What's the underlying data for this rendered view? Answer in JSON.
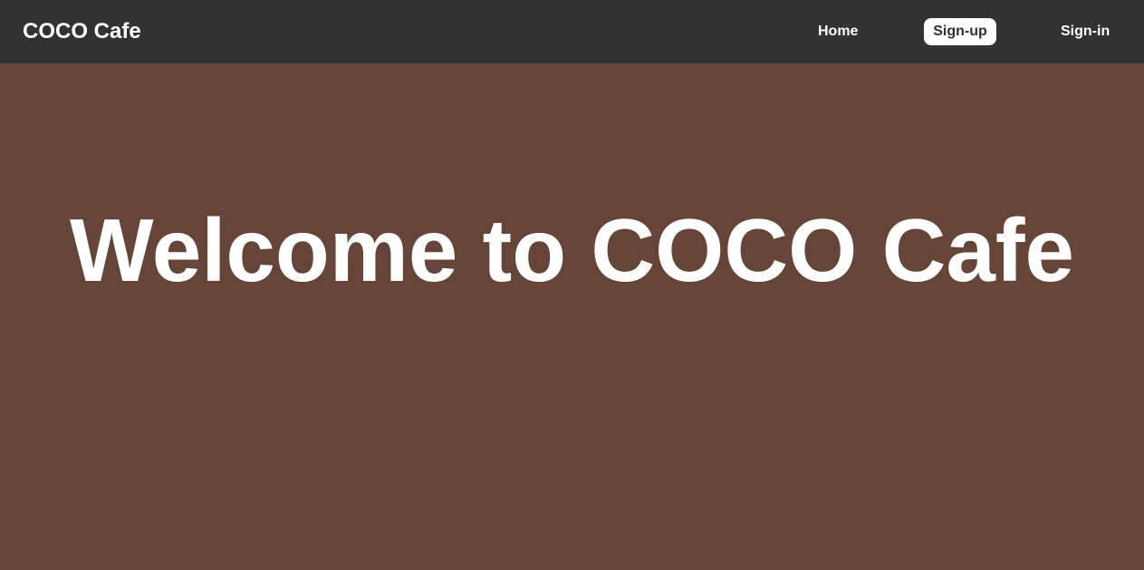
{
  "navbar": {
    "brand": "COCO Cafe",
    "links": [
      {
        "label": "Home",
        "active": false
      },
      {
        "label": "Sign-up",
        "active": true
      },
      {
        "label": "Sign-in",
        "active": false
      }
    ]
  },
  "hero": {
    "title": "Welcome to COCO Cafe"
  },
  "colors": {
    "navbar_bg": "#333233",
    "page_bg": "#654537",
    "text": "#ffffff",
    "active_pill_bg": "#ffffff",
    "active_pill_text": "#333233"
  }
}
